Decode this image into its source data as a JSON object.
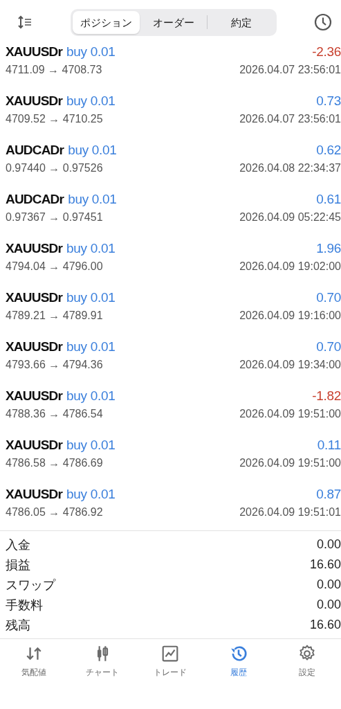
{
  "segments": [
    {
      "label": "ポジション",
      "selected": true
    },
    {
      "label": "オーダー",
      "selected": false
    },
    {
      "label": "約定",
      "selected": false
    }
  ],
  "trades": [
    {
      "symbol": "XAUUSDr",
      "side": "buy 0.01",
      "profit": "-2.36",
      "color": "#c8412f",
      "prices": "4711.09 → 4708.73",
      "time": "2026.04.07 23:56:01"
    },
    {
      "symbol": "XAUUSDr",
      "side": "buy 0.01",
      "profit": "0.73",
      "color": "#3a7fdc",
      "prices": "4709.52 → 4710.25",
      "time": "2026.04.07 23:56:01"
    },
    {
      "symbol": "AUDCADr",
      "side": "buy 0.01",
      "profit": "0.62",
      "color": "#3a7fdc",
      "prices": "0.97440 → 0.97526",
      "time": "2026.04.08 22:34:37"
    },
    {
      "symbol": "AUDCADr",
      "side": "buy 0.01",
      "profit": "0.61",
      "color": "#3a7fdc",
      "prices": "0.97367 → 0.97451",
      "time": "2026.04.09 05:22:45"
    },
    {
      "symbol": "XAUUSDr",
      "side": "buy 0.01",
      "profit": "1.96",
      "color": "#3a7fdc",
      "prices": "4794.04 → 4796.00",
      "time": "2026.04.09 19:02:00"
    },
    {
      "symbol": "XAUUSDr",
      "side": "buy 0.01",
      "profit": "0.70",
      "color": "#3a7fdc",
      "prices": "4789.21 → 4789.91",
      "time": "2026.04.09 19:16:00"
    },
    {
      "symbol": "XAUUSDr",
      "side": "buy 0.01",
      "profit": "0.70",
      "color": "#3a7fdc",
      "prices": "4793.66 → 4794.36",
      "time": "2026.04.09 19:34:00"
    },
    {
      "symbol": "XAUUSDr",
      "side": "buy 0.01",
      "profit": "-1.82",
      "color": "#c8412f",
      "prices": "4788.36 → 4786.54",
      "time": "2026.04.09 19:51:00"
    },
    {
      "symbol": "XAUUSDr",
      "side": "buy 0.01",
      "profit": "0.11",
      "color": "#3a7fdc",
      "prices": "4786.58 → 4786.69",
      "time": "2026.04.09 19:51:00"
    },
    {
      "symbol": "XAUUSDr",
      "side": "buy 0.01",
      "profit": "0.87",
      "color": "#3a7fdc",
      "prices": "4786.05 → 4786.92",
      "time": "2026.04.09 19:51:01"
    }
  ],
  "summary": [
    {
      "label": "入金",
      "value": "0.00"
    },
    {
      "label": "損益",
      "value": "16.60"
    },
    {
      "label": "スワップ",
      "value": "0.00"
    },
    {
      "label": "手数料",
      "value": "0.00"
    },
    {
      "label": "残高",
      "value": "16.60"
    }
  ],
  "nav": [
    {
      "kind": "quotes",
      "label": "気配値",
      "selected": false
    },
    {
      "kind": "chart",
      "label": "チャート",
      "selected": false
    },
    {
      "kind": "trade",
      "label": "トレード",
      "selected": false
    },
    {
      "kind": "history",
      "label": "履歴",
      "selected": true
    },
    {
      "kind": "settings",
      "label": "設定",
      "selected": false
    }
  ]
}
